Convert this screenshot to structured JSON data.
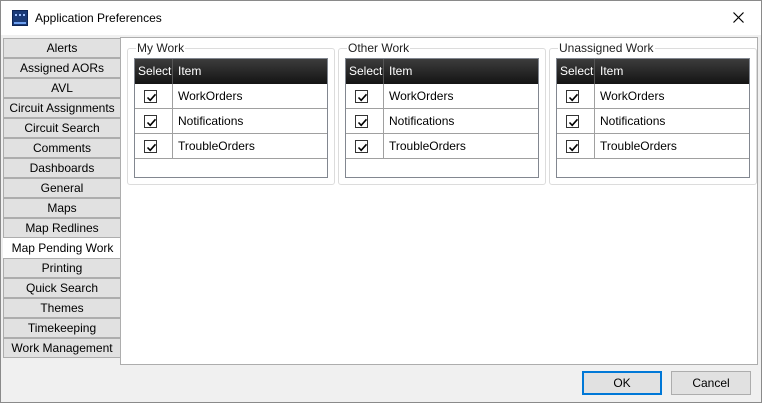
{
  "window": {
    "title": "Application Preferences",
    "icon": "app-logo-icon",
    "close_icon": "close-icon"
  },
  "tabs": [
    {
      "label": "Alerts",
      "selected": false
    },
    {
      "label": "Assigned AORs",
      "selected": false
    },
    {
      "label": "AVL",
      "selected": false
    },
    {
      "label": "Circuit Assignments",
      "selected": false
    },
    {
      "label": "Circuit Search",
      "selected": false
    },
    {
      "label": "Comments",
      "selected": false
    },
    {
      "label": "Dashboards",
      "selected": false
    },
    {
      "label": "General",
      "selected": false
    },
    {
      "label": "Maps",
      "selected": false
    },
    {
      "label": "Map Redlines",
      "selected": false
    },
    {
      "label": "Map Pending Work",
      "selected": true
    },
    {
      "label": "Printing",
      "selected": false
    },
    {
      "label": "Quick Search",
      "selected": false
    },
    {
      "label": "Themes",
      "selected": false
    },
    {
      "label": "Timekeeping",
      "selected": false
    },
    {
      "label": "Work Management",
      "selected": false
    }
  ],
  "columns": {
    "select": "Select",
    "item": "Item"
  },
  "groups": [
    {
      "label": "My Work",
      "rows": [
        {
          "item": "WorkOrders",
          "checked": true
        },
        {
          "item": "Notifications",
          "checked": true
        },
        {
          "item": "TroubleOrders",
          "checked": true
        }
      ]
    },
    {
      "label": "Other Work",
      "rows": [
        {
          "item": "WorkOrders",
          "checked": true
        },
        {
          "item": "Notifications",
          "checked": true
        },
        {
          "item": "TroubleOrders",
          "checked": true
        }
      ]
    },
    {
      "label": "Unassigned Work",
      "rows": [
        {
          "item": "WorkOrders",
          "checked": true
        },
        {
          "item": "Notifications",
          "checked": true
        },
        {
          "item": "TroubleOrders",
          "checked": true
        }
      ]
    }
  ],
  "buttons": {
    "ok": "OK",
    "cancel": "Cancel"
  },
  "colors": {
    "default_button_border": "#0078d7",
    "grid_header": "#1e1e1e"
  }
}
